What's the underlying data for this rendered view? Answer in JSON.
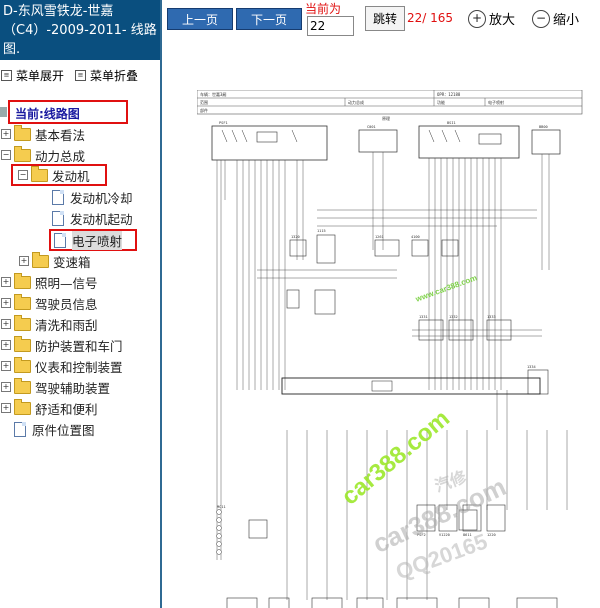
{
  "app": {
    "title": "D-东风雪铁龙-世嘉（C4）-2009-2011- 线路图."
  },
  "menu_bar": {
    "expand_label": "菜单展开",
    "collapse_label": "菜单折叠"
  },
  "current_label": "当前:线路图",
  "tree": {
    "basic": "基本看法",
    "powertrain": "动力总成",
    "engine": "发动机",
    "engine_cooling": "发动机冷却",
    "engine_start": "发动机起动",
    "efi": "电子喷射",
    "gearbox": "变速箱",
    "lighting": "照明—信号",
    "driver_info": "驾驶员信息",
    "wash_wipe": "清洗和雨刮",
    "protection": "防护装置和车门",
    "instruments": "仪表和控制装置",
    "driver_assist": "驾驶辅助装置",
    "comfort": "舒适和便利",
    "parts_location": "原件位置图"
  },
  "toolbar": {
    "prev_label": "上一页",
    "next_label": "下一页",
    "current_page_label": "当前为",
    "page_value": "22",
    "jump_label": "跳转",
    "page_count": "22/ 165",
    "zoom_in_label": "放大",
    "zoom_out_label": "缩小"
  },
  "diagram": {
    "row1_vehicle": "车辆：世嘉3厢",
    "row1_opr": "OPR：12188",
    "row2_range": "范围",
    "row2_group": "动力总成",
    "row2_function": "功能",
    "row2_value": "电子喷射",
    "row3_part": "部件",
    "schematic_label": "原理",
    "green_watermark": "www.car388.com",
    "big_watermark_1": "car388.com",
    "big_watermark_2": "car388.com",
    "big_watermark_3": "QQ20165",
    "small_watermark": "汽修",
    "components": [
      "PSF1",
      "BSI1",
      "C001",
      "BB00",
      "1320",
      "1115",
      "1261",
      "4100",
      "1331",
      "1332",
      "1333",
      "1334",
      "MC11",
      "PSF2",
      "V1220",
      "8611",
      "1220"
    ]
  },
  "colors": {
    "title_bg": "#0a4f7f",
    "nav_button": "#2f6ab0",
    "highlight_red": "#e01010"
  }
}
